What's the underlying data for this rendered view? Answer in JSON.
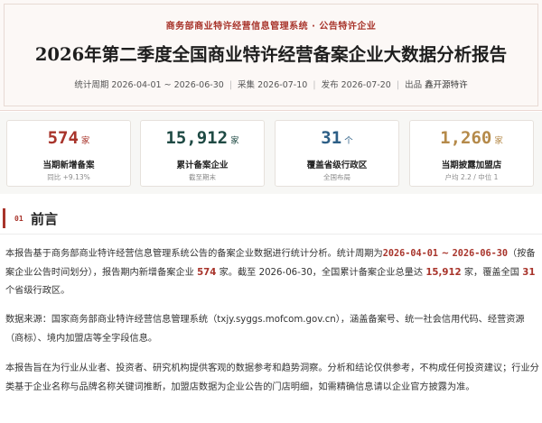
{
  "header": {
    "tag": "商务部商业特许经营信息管理系统 · 公告特许企业",
    "title": "2026年第二季度全国商业特许经营备案企业大数据分析报告",
    "meta": {
      "period_label": "统计周期",
      "period_value": "2026-04-01 ~ 2026-06-30",
      "collect_label": "采集",
      "collect_value": "2026-07-10",
      "publish_label": "发布",
      "publish_value": "2026-07-20",
      "source_label": "出品",
      "source_value": "鑫开源特许"
    }
  },
  "stats": [
    {
      "value": "574",
      "unit": "家",
      "label": "当期新增备案",
      "sub": "同比 +9.13%",
      "color": "#a8342b"
    },
    {
      "value": "15,912",
      "unit": "家",
      "label": "累计备案企业",
      "sub": "截至期末",
      "color": "#1f4a44"
    },
    {
      "value": "31",
      "unit": "个",
      "label": "覆盖省级行政区",
      "sub": "全国布局",
      "color": "#2d5f86"
    },
    {
      "value": "1,260",
      "unit": "家",
      "label": "当期披露加盟店",
      "sub": "户均 2.2 / 中位 1",
      "color": "#b58a4a"
    }
  ],
  "section": {
    "number": "01",
    "title": "前言"
  },
  "intro": {
    "p1": {
      "a": "本报告基于商务部商业特许经营信息管理系统公告的备案企业数据进行统计分析。统计周期为",
      "period_start": "2026-04-01",
      "tilde": " ~ ",
      "period_end": "2026-06-30",
      "b": "（按备案企业公告时间划分），报告期内新增备案企业",
      "new": "574",
      "c": "家。截至 2026-06-30，全国累计备案企业总量达",
      "total": "15,912",
      "d": "家，覆盖全国",
      "provinces": "31",
      "e": "个省级行政区。"
    },
    "p2": "数据来源：国家商务部商业特许经营信息管理系统（txjy.syggs.mofcom.gov.cn），涵盖备案号、统一社会信用代码、经营资源（商标）、境内加盟店等全字段信息。",
    "p3": "本报告旨在为行业从业者、投资者、研究机构提供客观的数据参考和趋势洞察。分析和结论仅供参考，不构成任何投资建议；行业分类基于企业名称与品牌名称关键词推断，加盟店数据为企业公告的门店明细，如需精确信息请以企业官方披露为准。"
  }
}
